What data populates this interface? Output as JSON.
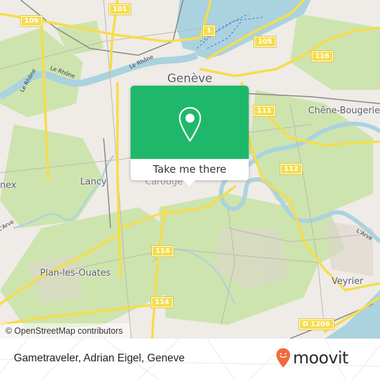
{
  "map": {
    "places": [
      {
        "name": "Genève",
        "key": "geneve"
      },
      {
        "name": "Chêne-Bougerie",
        "key": "chene-bougerie"
      },
      {
        "name": "Lancy",
        "key": "lancy"
      },
      {
        "name": "nex",
        "key": "onex"
      },
      {
        "name": "Plan-les-Ouates",
        "key": "plan-les-ouates"
      },
      {
        "name": "Veyrier",
        "key": "veyrier"
      },
      {
        "name": "Carouge",
        "key": "carouge"
      }
    ],
    "rivers": [
      {
        "name": "Le Rhône",
        "key": "rhone-1"
      },
      {
        "name": "Le Rhône",
        "key": "rhone-2"
      },
      {
        "name": "Le Rhône",
        "key": "rhone-3"
      },
      {
        "name": "L'Arve",
        "key": "arve-1"
      },
      {
        "name": "L'Arve",
        "key": "arve-2"
      }
    ],
    "road_shields": [
      "101",
      "109",
      "1",
      "105",
      "116",
      "111",
      "112",
      "114",
      "114",
      "D 1206"
    ],
    "attribution": "© OpenStreetMap contributors",
    "colors": {
      "water": "#aad3df",
      "land": "#efebe6",
      "park": "#c8e3a5",
      "road": "#f5dd4b",
      "popup_green": "#1fb86a"
    }
  },
  "popup": {
    "icon": "map-pin-icon",
    "button_label": "Take me there"
  },
  "footer": {
    "title": "Gametraveler, Adrian Eigel, Geneve",
    "logo_text": "moovit",
    "logo_color": "#f26a3b"
  }
}
